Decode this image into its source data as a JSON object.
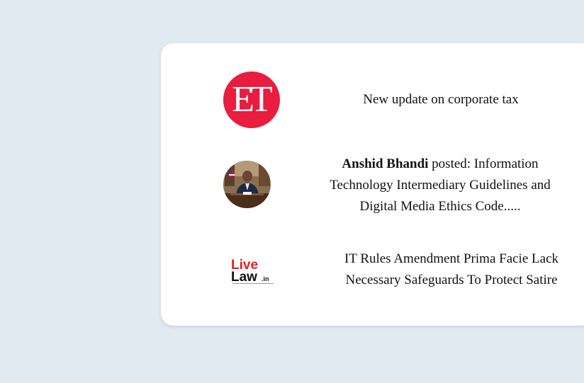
{
  "feed": {
    "items": [
      {
        "logo_text": "ET",
        "text": "New update on corporate tax"
      },
      {
        "author": "Anshid Bhandi",
        "text": " posted: Information Technology Intermediary Guidelines and Digital Media Ethics Code....."
      },
      {
        "logo_text_top": "Live",
        "logo_text_bottom": "Law",
        "logo_suffix": ".in",
        "text": "IT Rules Amendment Prima Facie Lack Necessary Safeguards To Protect Satire"
      }
    ]
  },
  "colors": {
    "background": "#e2eaf1",
    "card": "#ffffff",
    "et_red": "#ea1c3f",
    "livelaw_red": "#e31e24"
  }
}
